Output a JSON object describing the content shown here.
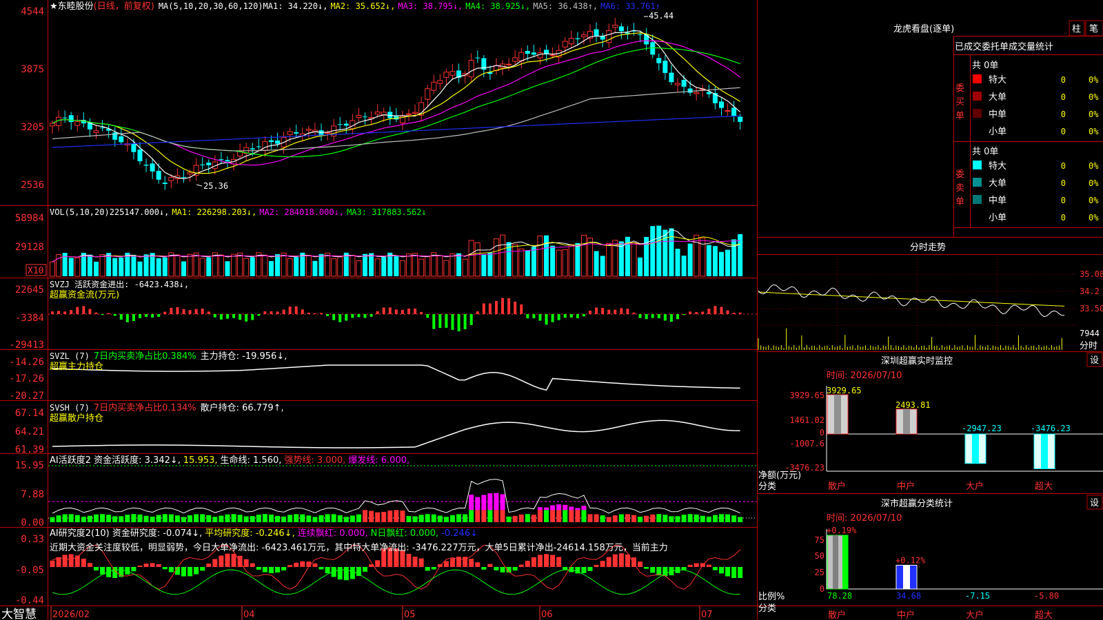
{
  "app": {
    "name": "大智慧"
  },
  "colors": {
    "up": "#ff3232",
    "down": "#00ffff",
    "frame": "#c00000",
    "white": "#ffffff",
    "yellow": "#ffff00",
    "magenta": "#ff00ff",
    "green": "#00ff00",
    "blue": "#2030ff"
  },
  "stock": {
    "header": "★东睦股份",
    "period": "(日线，前复权)",
    "ma_params": "MA(5,10,20,30,60,120)",
    "ma_values": [
      {
        "label": "MA1: 34.220↓,",
        "color": "#ffffff"
      },
      {
        "label": "MA2: 35.652↓,",
        "color": "#ffff00"
      },
      {
        "label": "MA3: 38.795↓,",
        "color": "#ff00ff"
      },
      {
        "label": "MA4: 38.925↓,",
        "color": "#00ff00"
      },
      {
        "label": "MA5: 36.438↑,",
        "color": "#c0c0c0"
      },
      {
        "label": "MA6: 33.761↑",
        "color": "#2030ff"
      }
    ],
    "price_axis": [
      "4544",
      "3875",
      "3205",
      "2536"
    ],
    "high_label": "45.44",
    "low_label": "25.36"
  },
  "volume": {
    "header": "VOL(5,10,20)",
    "values": [
      {
        "label": "225147.000↓,",
        "color": "#ffffff"
      },
      {
        "label": "MA1: 226298.203↓,",
        "color": "#ffff00"
      },
      {
        "label": "MA2: 284018.000↓,",
        "color": "#ff00ff"
      },
      {
        "label": "MA3: 317883.562↓",
        "color": "#00ff00"
      }
    ],
    "axis": [
      "58984",
      "29128"
    ],
    "unit": "X10"
  },
  "svzj": {
    "line1": "SVZJ  活跃资金进出: -6423.438↓,",
    "line2": "超赢资金流(万元)",
    "axis": [
      "22645",
      "-3384",
      "-29413"
    ]
  },
  "svzl": {
    "part1": "SVZL (7)",
    "part2": "7日内买卖净占比0.384%",
    "part3": "主力持仓: -19.956↓,",
    "line2": "超赢主力持仓",
    "axis": [
      "-14.26",
      "-17.26",
      "-20.27"
    ]
  },
  "svsh": {
    "part1": "SVSH (7)",
    "part2": "7日内买卖净占比0.134%",
    "part3": "散户持仓: 66.779↑,",
    "line2": "超赢散户持仓",
    "axis": [
      "67.14",
      "64.21",
      "61.39"
    ]
  },
  "aihy": {
    "parts": [
      {
        "label": "AI活跃度2 资金活跃度: 3.342↓,",
        "color": "#ffffff"
      },
      {
        "label": "15.953,",
        "color": "#ffff00"
      },
      {
        "label": "生命线: 1.560,",
        "color": "#ffffff"
      },
      {
        "label": "强势线: 3.000,",
        "color": "#ff3232"
      },
      {
        "label": "爆发线: 6.000,",
        "color": "#ff00ff"
      }
    ],
    "axis": [
      "15.95",
      "7.88",
      "0.00"
    ]
  },
  "aiyj": {
    "parts": [
      {
        "label": "AI研究度2(10) 资金研究度: -0.074↓,",
        "color": "#ffffff"
      },
      {
        "label": "平均研究度: -0.246↓,",
        "color": "#ffff00"
      },
      {
        "label": "连续飘红: 0.000,",
        "color": "#ff00ff"
      },
      {
        "label": "N日飘红: 0.000,",
        "color": "#00ff00"
      },
      {
        "label": "-0.246↓",
        "color": "#2030ff"
      }
    ],
    "comment": "近期大资金关注度较低，明显弱势，今日大单净流出: -6423.461万元，其中特大单净流出: -3476.227万元，大单5日累计净出-24614.158万元，当前主力",
    "axis": [
      "0.33",
      "-0.05",
      "-0.44"
    ]
  },
  "date_axis": [
    "2026/02",
    "04",
    "05",
    "06",
    "07"
  ],
  "right_panel": {
    "dragon_title": "龙虎看盘(逐单)",
    "btn_bar": "柱",
    "btn_pen": "笔",
    "tab_title": "已成交委托单成交量统计",
    "buy": {
      "side": "委买单",
      "total": "共 0单",
      "rows": [
        {
          "label": "特大",
          "count": "0",
          "pct": "0%",
          "color": "#ff0000"
        },
        {
          "label": "大单",
          "count": "0",
          "pct": "0%",
          "color": "#a00000"
        },
        {
          "label": "中单",
          "count": "0",
          "pct": "0%",
          "color": "#600000"
        },
        {
          "label": "小单",
          "count": "0",
          "pct": "0%",
          "color": "#000000"
        }
      ]
    },
    "sell": {
      "side": "委卖单",
      "total": "共 0单",
      "rows": [
        {
          "label": "特大",
          "count": "0",
          "pct": "0%",
          "color": "#00ffff"
        },
        {
          "label": "大单",
          "count": "0",
          "pct": "0%",
          "color": "#009090"
        },
        {
          "label": "中单",
          "count": "0",
          "pct": "0%",
          "color": "#007878"
        },
        {
          "label": "小单",
          "count": "0",
          "pct": "0%",
          "color": "#000000"
        }
      ]
    },
    "intraday": {
      "title": "分时走势",
      "axis": [
        "35.08",
        "34.2",
        "33.50"
      ],
      "vol_label": "7944",
      "vol_caption": "分时"
    },
    "monitor": {
      "title": "深圳超赢实时监控",
      "btn": "设",
      "date": "时间: 2026/07/10",
      "axis": [
        "3929.65",
        "1461.02",
        "0",
        "-1007.6",
        "-3476.23"
      ],
      "ylabel_1": "净额(万元)",
      "ylabel_2": "分类",
      "categories": [
        "散户",
        "中户",
        "大户",
        "超大"
      ],
      "values": [
        3929.65,
        2493.81,
        -2947.23,
        -3476.23
      ],
      "value_labels": [
        "3929.65",
        "2493.81",
        "-2947.23",
        "-3476.23"
      ]
    },
    "classify": {
      "title": "深市超赢分类统计",
      "btn": "设",
      "date": "时间: 2026/07/10",
      "axis": [
        "75",
        "50",
        "25",
        "0"
      ],
      "ylabel_1": "比例%",
      "ylabel_2": "分类",
      "categories": [
        "散户",
        "中户",
        "大户",
        "超大"
      ],
      "values": [
        78.28,
        34.68,
        -7.15,
        -5.8
      ],
      "value_labels": [
        "78.28",
        "34.68",
        "-7.15",
        "-5.80"
      ],
      "change_labels": [
        "+0.19%",
        "+0.12%"
      ]
    }
  },
  "chart_data": [
    {
      "type": "line",
      "title": "★东睦股份 (日线，前复权)",
      "x": [
        "2026/02",
        "04",
        "05",
        "06",
        "07"
      ],
      "ylim": [
        25.36,
        45.44
      ],
      "series": [
        {
          "name": "MA1",
          "last": 34.22
        },
        {
          "name": "MA2",
          "last": 35.652
        },
        {
          "name": "MA3",
          "last": 38.795
        },
        {
          "name": "MA4",
          "last": 38.925
        },
        {
          "name": "MA5",
          "last": 36.438
        },
        {
          "name": "MA6",
          "last": 33.761
        }
      ],
      "annotations": [
        "45.44",
        "25.36"
      ]
    },
    {
      "type": "bar",
      "title": "VOL(5,10,20)",
      "last_volume": 225147.0,
      "ylim": [
        0,
        58984
      ]
    },
    {
      "type": "bar",
      "title": "深圳超赢实时监控",
      "categories": [
        "散户",
        "中户",
        "大户",
        "超大"
      ],
      "values": [
        3929.65,
        2493.81,
        -2947.23,
        -3476.23
      ],
      "ylabel": "净额(万元)",
      "ylim": [
        -3476.23,
        3929.65
      ]
    },
    {
      "type": "bar",
      "title": "深市超赢分类统计",
      "categories": [
        "散户",
        "中户",
        "大户",
        "超大"
      ],
      "values": [
        78.28,
        34.68,
        -7.15,
        -5.8
      ],
      "ylabel": "比例%",
      "ylim": [
        0,
        75
      ]
    }
  ]
}
